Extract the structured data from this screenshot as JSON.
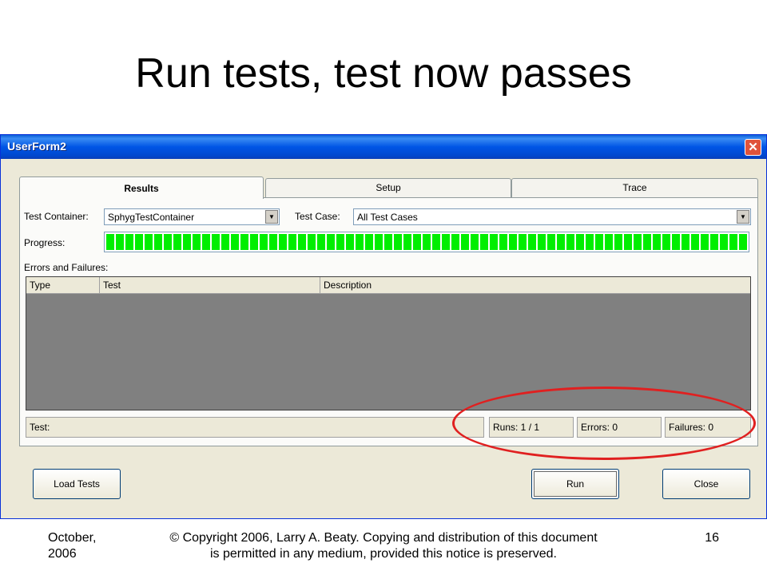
{
  "slide": {
    "title": "Run tests, test now passes",
    "footer_date": "October, 2006",
    "footer_copyright_line1": "© Copyright 2006, Larry A. Beaty.  Copying and distribution of this document",
    "footer_copyright_line2": "is permitted in any medium, provided this notice is preserved.",
    "page_number": "16"
  },
  "window": {
    "title": "UserForm2",
    "close_glyph": "✕",
    "tabs": [
      {
        "label": "Results",
        "active": true
      },
      {
        "label": "Setup",
        "active": false
      },
      {
        "label": "Trace",
        "active": false
      }
    ],
    "results": {
      "test_container_label": "Test Container:",
      "test_container_value": "SphygTestContainer",
      "test_case_label": "Test Case:",
      "test_case_value": "All Test Cases",
      "progress_label": "Progress:",
      "progress_fraction": 1.0,
      "errors_failures_label": "Errors and Failures:",
      "columns": [
        "Type",
        "Test",
        "Description"
      ],
      "status": {
        "test": "Test:",
        "runs": "Runs: 1 / 1",
        "errors": "Errors: 0",
        "failures": "Failures: 0"
      }
    },
    "buttons": {
      "load_tests": "Load Tests",
      "run": "Run",
      "close": "Close"
    }
  },
  "colors": {
    "progress_fill": "#00ee00",
    "highlight": "#e02020",
    "titlebar": "#0055e5"
  },
  "icons": {
    "close": "close-icon",
    "dropdown": "chevron-down-icon"
  }
}
